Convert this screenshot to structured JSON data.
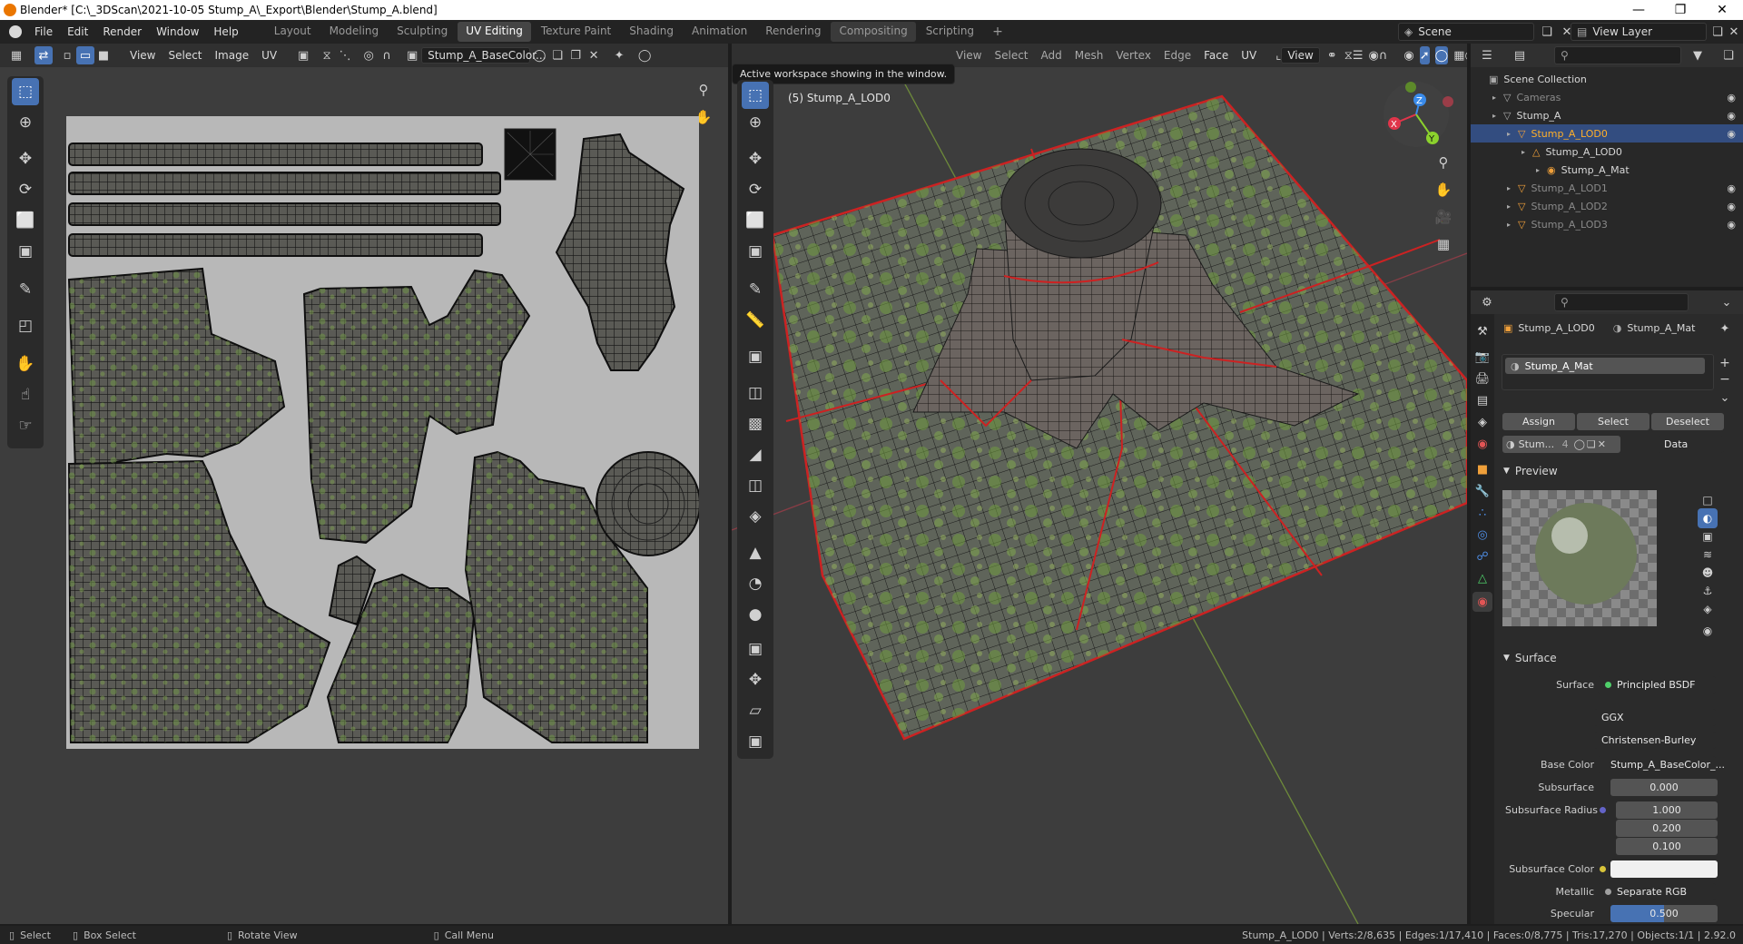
{
  "window": {
    "title": "Blender* [C:\\_3DScan\\2021-10-05 Stump_A\\_Export\\Blender\\Stump_A.blend]"
  },
  "menus": [
    "File",
    "Edit",
    "Render",
    "Window",
    "Help"
  ],
  "workspaces": [
    "Layout",
    "Modeling",
    "Sculpting",
    "UV Editing",
    "Texture Paint",
    "Shading",
    "Animation",
    "Rendering",
    "Compositing",
    "Scripting"
  ],
  "active_workspace": "UV Editing",
  "scene": "Scene",
  "view_layer": "View Layer",
  "uv_editor": {
    "menus": [
      "View",
      "Select",
      "Image",
      "UV"
    ],
    "image_name": "Stump_A_BaseColor..."
  },
  "viewport": {
    "menus": [
      "View",
      "Select",
      "Add",
      "Mesh",
      "Vertex",
      "Edge",
      "Face",
      "UV"
    ],
    "object_label": "(5) Stump_A_LOD0",
    "tooltip": "Active workspace showing in the window.",
    "view_label": "View"
  },
  "outliner": {
    "root": "Scene Collection",
    "items": [
      {
        "name": "Cameras",
        "indent": 1,
        "dim": true
      },
      {
        "name": "Stump_A",
        "indent": 1,
        "dim": false
      },
      {
        "name": "Stump_A_LOD0",
        "indent": 2,
        "dim": false,
        "selected": true
      },
      {
        "name": "Stump_A_LOD0",
        "indent": 3,
        "dim": false
      },
      {
        "name": "Stump_A_Mat",
        "indent": 4,
        "dim": false
      },
      {
        "name": "Stump_A_LOD1",
        "indent": 2,
        "dim": true
      },
      {
        "name": "Stump_A_LOD2",
        "indent": 2,
        "dim": true
      },
      {
        "name": "Stump_A_LOD3",
        "indent": 2,
        "dim": true
      }
    ]
  },
  "properties": {
    "object_name": "Stump_A_LOD0",
    "material_name": "Stump_A_Mat",
    "slot_name": "Stump_A_Mat",
    "buttons": {
      "assign": "Assign",
      "select": "Select",
      "deselect": "Deselect"
    },
    "mat_short": "Stum...",
    "mat_users": "4",
    "link": "Data",
    "preview_label": "Preview",
    "surface_label": "Surface",
    "fields": {
      "surface_name": "Surface",
      "surface_value": "Principled BSDF",
      "distribution": "GGX",
      "subsurface_method": "Christensen-Burley",
      "base_color_name": "Base Color",
      "base_color_value": "Stump_A_BaseColor_...",
      "subsurface_name": "Subsurface",
      "subsurface_value": "0.000",
      "subsurface_radius_name": "Subsurface Radius",
      "radius": [
        "1.000",
        "0.200",
        "0.100"
      ],
      "subsurface_color_name": "Subsurface Color",
      "metallic_name": "Metallic",
      "metallic_value": "Separate RGB",
      "specular_name": "Specular",
      "specular_value": "0.500"
    }
  },
  "statusbar": {
    "select": "Select",
    "box_select": "Box Select",
    "rotate": "Rotate View",
    "call_menu": "Call Menu",
    "stats": "Stump_A_LOD0 | Verts:2/8,635 | Edges:1/17,410 | Faces:0/8,775 | Tris:17,270 | Objects:1/1 | 2.92.0"
  },
  "colors": {
    "accent": "#4772b3",
    "selection": "#334d80",
    "seam": "#cc2222",
    "x_axis": "#e0354a",
    "y_axis": "#8bd12d",
    "z_axis": "#3a8bea"
  }
}
